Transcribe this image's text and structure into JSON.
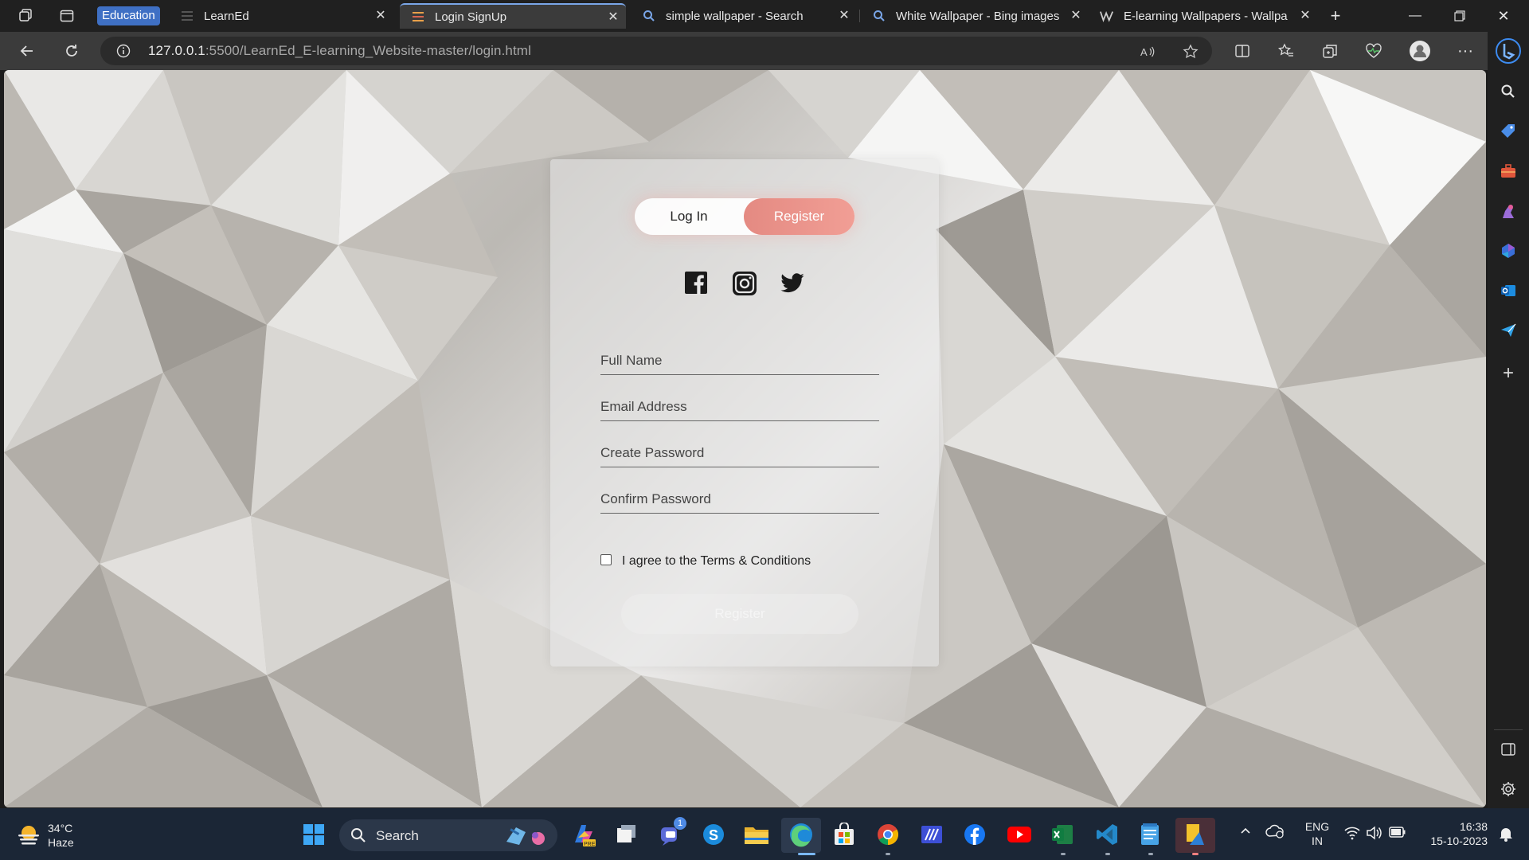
{
  "browser": {
    "tab_group_label": "Education",
    "tabs": [
      {
        "label": "LearnEd",
        "icon": "learned-favicon-icon"
      },
      {
        "label": "Login SignUp",
        "icon": "learned-favicon-icon",
        "active": true
      },
      {
        "label": "simple wallpaper - Search",
        "icon": "bing-search-icon"
      },
      {
        "label": "White Wallpaper - Bing images",
        "icon": "bing-search-icon"
      },
      {
        "label": "E-learning Wallpapers - Wallpa",
        "icon": "wallpaper-site-icon"
      }
    ],
    "url_host": "127.0.0.1",
    "url_path": ":5500/LearnEd_E-learning_Website-master/login.html",
    "accent": "#7aa6e8"
  },
  "page": {
    "toggle": {
      "login_label": "Log In",
      "register_label": "Register"
    },
    "social": [
      "facebook-icon",
      "instagram-icon",
      "twitter-icon"
    ],
    "fields": {
      "full_name_placeholder": "Full Name",
      "email_placeholder": "Email Address",
      "password_placeholder": "Create Password",
      "confirm_placeholder": "Confirm Password"
    },
    "terms_label": "I agree to the Terms & Conditions",
    "terms_checked": false,
    "submit_label": "Register",
    "accent_color": "#ee958c"
  },
  "taskbar": {
    "weather_temp": "34°C",
    "weather_desc": "Haze",
    "search_label": "Search",
    "teams_badge": "1",
    "lang_top": "ENG",
    "lang_bottom": "IN",
    "time": "16:38",
    "date": "15-10-2023"
  }
}
